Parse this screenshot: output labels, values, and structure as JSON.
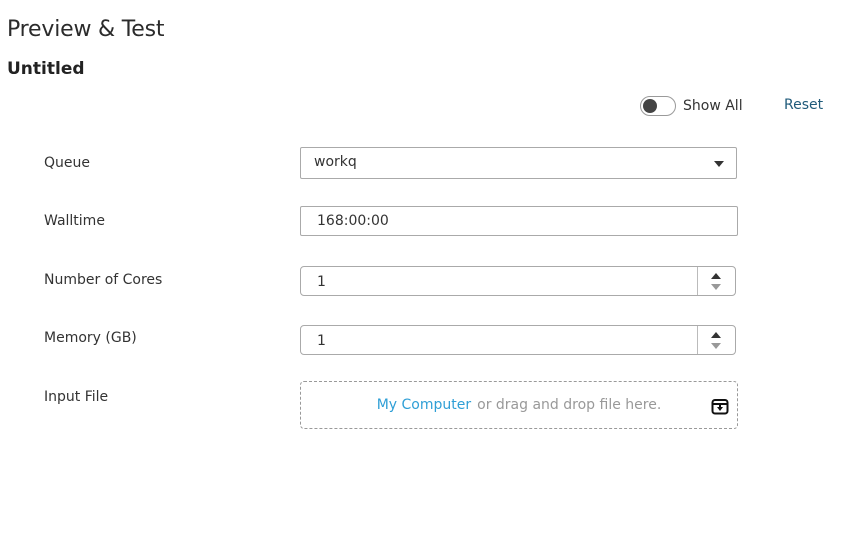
{
  "header": {
    "title": "Preview & Test",
    "subtitle": "Untitled"
  },
  "controls": {
    "show_all_label": "Show All",
    "show_all_on": false,
    "reset_label": "Reset"
  },
  "form": {
    "queue": {
      "label": "Queue",
      "value": "workq"
    },
    "walltime": {
      "label": "Walltime",
      "value": "168:00:00"
    },
    "cores": {
      "label": "Number of Cores",
      "value": "1"
    },
    "memory": {
      "label": "Memory (GB)",
      "value": "1"
    },
    "input_file": {
      "label": "Input File",
      "link_text": "My Computer",
      "drop_text": "or drag and drop file here.",
      "icon": "archive-download-icon"
    }
  }
}
